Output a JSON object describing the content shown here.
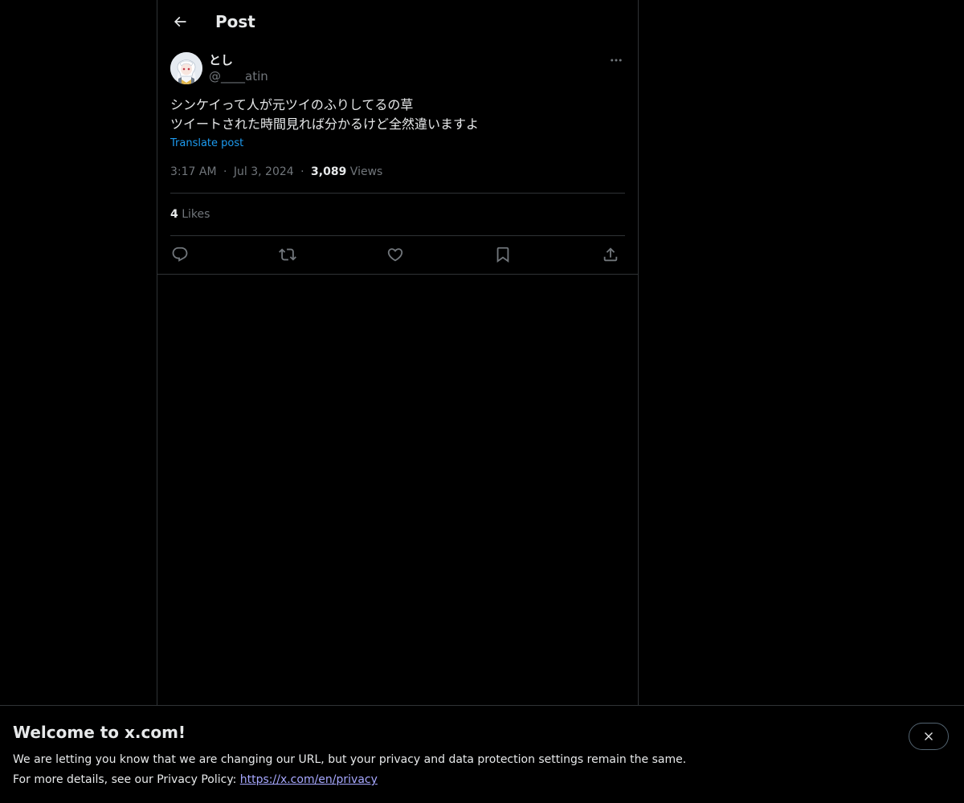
{
  "header": {
    "title": "Post",
    "back_icon": "arrow-left-icon"
  },
  "post": {
    "author": {
      "display_name": "とし",
      "handle": "@____atin",
      "avatar_icon": "avatar-illustration"
    },
    "more_icon": "ellipsis-icon",
    "text_lines": [
      "シンケイって人が元ツイのふりしてるの草",
      "ツイートされた時間見れば分かるけど全然違いますよ"
    ],
    "translate_label": "Translate post",
    "time": "3:17 AM",
    "date": "Jul 3, 2024",
    "separator": "·",
    "views_count": "3,089",
    "views_label": "Views",
    "likes_count": "4",
    "likes_label": "Likes",
    "actions": [
      {
        "name": "reply",
        "icon": "reply-icon"
      },
      {
        "name": "repost",
        "icon": "repost-icon"
      },
      {
        "name": "like",
        "icon": "heart-icon"
      },
      {
        "name": "bookmark",
        "icon": "bookmark-icon"
      },
      {
        "name": "share",
        "icon": "share-icon"
      }
    ]
  },
  "banner": {
    "title": "Welcome to x.com!",
    "line1": "We are letting you know that we are changing our URL, but your privacy and data protection settings remain the same.",
    "line2_prefix": "For more details, see our Privacy Policy: ",
    "privacy_link": "https://x.com/en/privacy",
    "close_icon": "close-icon"
  },
  "colors": {
    "background": "#000000",
    "text_primary": "#e7e9ea",
    "text_secondary": "#71767b",
    "accent": "#1d9bf0",
    "link": "#a7a8ff",
    "border": "#2f3336"
  }
}
